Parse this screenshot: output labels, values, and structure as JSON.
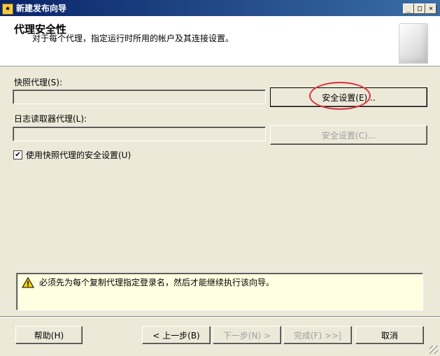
{
  "window": {
    "title": "新建发布向导",
    "controls": {
      "minimize": "_",
      "maximize": "□",
      "close": "×"
    }
  },
  "header": {
    "title": "代理安全性",
    "subtitle": "对于每个代理，指定运行时所用的帐户及其连接设置。"
  },
  "snapshot_agent": {
    "label": "快照代理(S):",
    "value": "",
    "button_label": "安全设置(E)..."
  },
  "log_reader_agent": {
    "label": "日志读取器代理(L):",
    "value": "",
    "button_label": "安全设置(C)..."
  },
  "use_snapshot_settings": {
    "label": "使用快照代理的安全设置(U)",
    "checked": true,
    "check_glyph": "✔"
  },
  "warning": {
    "icon": "warning-icon",
    "text": "必须先为每个复制代理指定登录名，然后才能继续执行该向导。"
  },
  "footer": {
    "help": "帮助(H)",
    "back": "< 上一步(B)",
    "next": "下一步(N) >",
    "finish": "完成(F) >>|",
    "cancel": "取消"
  },
  "colors": {
    "dialog_bg": "#ece9d8",
    "titlebar": "#0a246a",
    "warning_bg": "#ffffe1",
    "highlight": "#e0303a"
  }
}
